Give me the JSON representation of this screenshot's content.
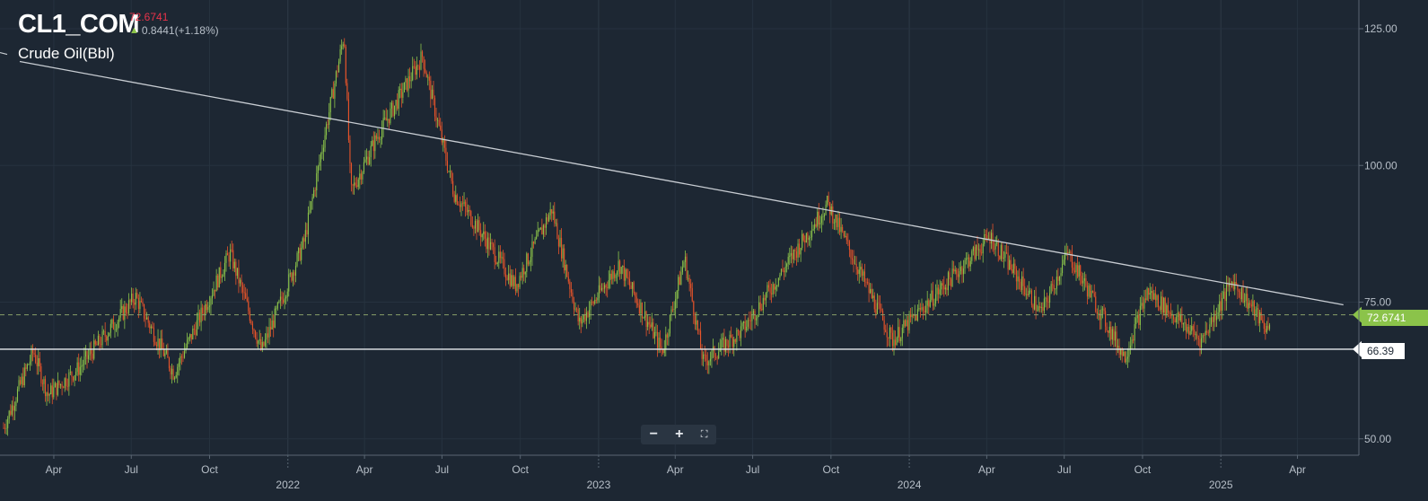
{
  "header": {
    "symbol": "CL1_COM",
    "last_price": "72.6741",
    "change": "0.8441(+1.18%)",
    "instrument_name": "Crude Oil(Bbl)",
    "change_icon": "arrow-up-icon"
  },
  "controls": {
    "zoom_out_label": "−",
    "zoom_in_label": "+",
    "fullscreen_icon": "fullscreen-icon"
  },
  "price_tags": {
    "current": "72.6741",
    "horizontal_line": "66.39"
  },
  "colors": {
    "background": "#1d2733",
    "up": "#8bc34a",
    "down": "#e8542a",
    "trendline": "#c8cdd3",
    "current_price_tag": "#8bc34a",
    "last_price_text": "#e8334a"
  },
  "chart_data": {
    "type": "candlestick",
    "y_axis": {
      "ticks": [
        "125.00",
        "100.00",
        "75.00",
        "50.00"
      ],
      "ylim": [
        47.5,
        128
      ]
    },
    "x_axis": {
      "month_labels": [
        "Apr",
        "Jul",
        "Oct",
        "Apr",
        "Jul",
        "Oct",
        "Apr",
        "Jul",
        "Oct",
        "Apr",
        "Jul",
        "Oct",
        "Apr"
      ],
      "year_labels": [
        "2022",
        "2023",
        "2024",
        "2025"
      ]
    },
    "path_points": [
      [
        "2021-02-01",
        52
      ],
      [
        "2021-03-08",
        66
      ],
      [
        "2021-03-25",
        58
      ],
      [
        "2021-05-01",
        63
      ],
      [
        "2021-07-06",
        76
      ],
      [
        "2021-08-20",
        62
      ],
      [
        "2021-10-25",
        84
      ],
      [
        "2021-12-01",
        66
      ],
      [
        "2022-01-20",
        86
      ],
      [
        "2022-03-08",
        124
      ],
      [
        "2022-03-16",
        95
      ],
      [
        "2022-04-15",
        105
      ],
      [
        "2022-06-08",
        120
      ],
      [
        "2022-07-15",
        95
      ],
      [
        "2022-08-15",
        88
      ],
      [
        "2022-09-25",
        78
      ],
      [
        "2022-11-07",
        92
      ],
      [
        "2022-12-09",
        71
      ],
      [
        "2023-01-25",
        82
      ],
      [
        "2023-03-17",
        66
      ],
      [
        "2023-04-12",
        83
      ],
      [
        "2023-05-04",
        64
      ],
      [
        "2023-06-20",
        70
      ],
      [
        "2023-09-27",
        93
      ],
      [
        "2023-12-12",
        68
      ],
      [
        "2024-04-05",
        87
      ],
      [
        "2024-06-04",
        73
      ],
      [
        "2024-07-05",
        84
      ],
      [
        "2024-09-10",
        65
      ],
      [
        "2024-10-07",
        77
      ],
      [
        "2024-12-09",
        68
      ],
      [
        "2025-01-15",
        79
      ],
      [
        "2025-02-24",
        70
      ],
      [
        "2025-02-28",
        72.67
      ]
    ],
    "trendline": {
      "from": [
        "2021-02-20",
        119
      ],
      "to": [
        "2025-05-25",
        74.5
      ]
    },
    "horizontal_level": 66.39,
    "current_price": 72.6741,
    "grid": true
  }
}
